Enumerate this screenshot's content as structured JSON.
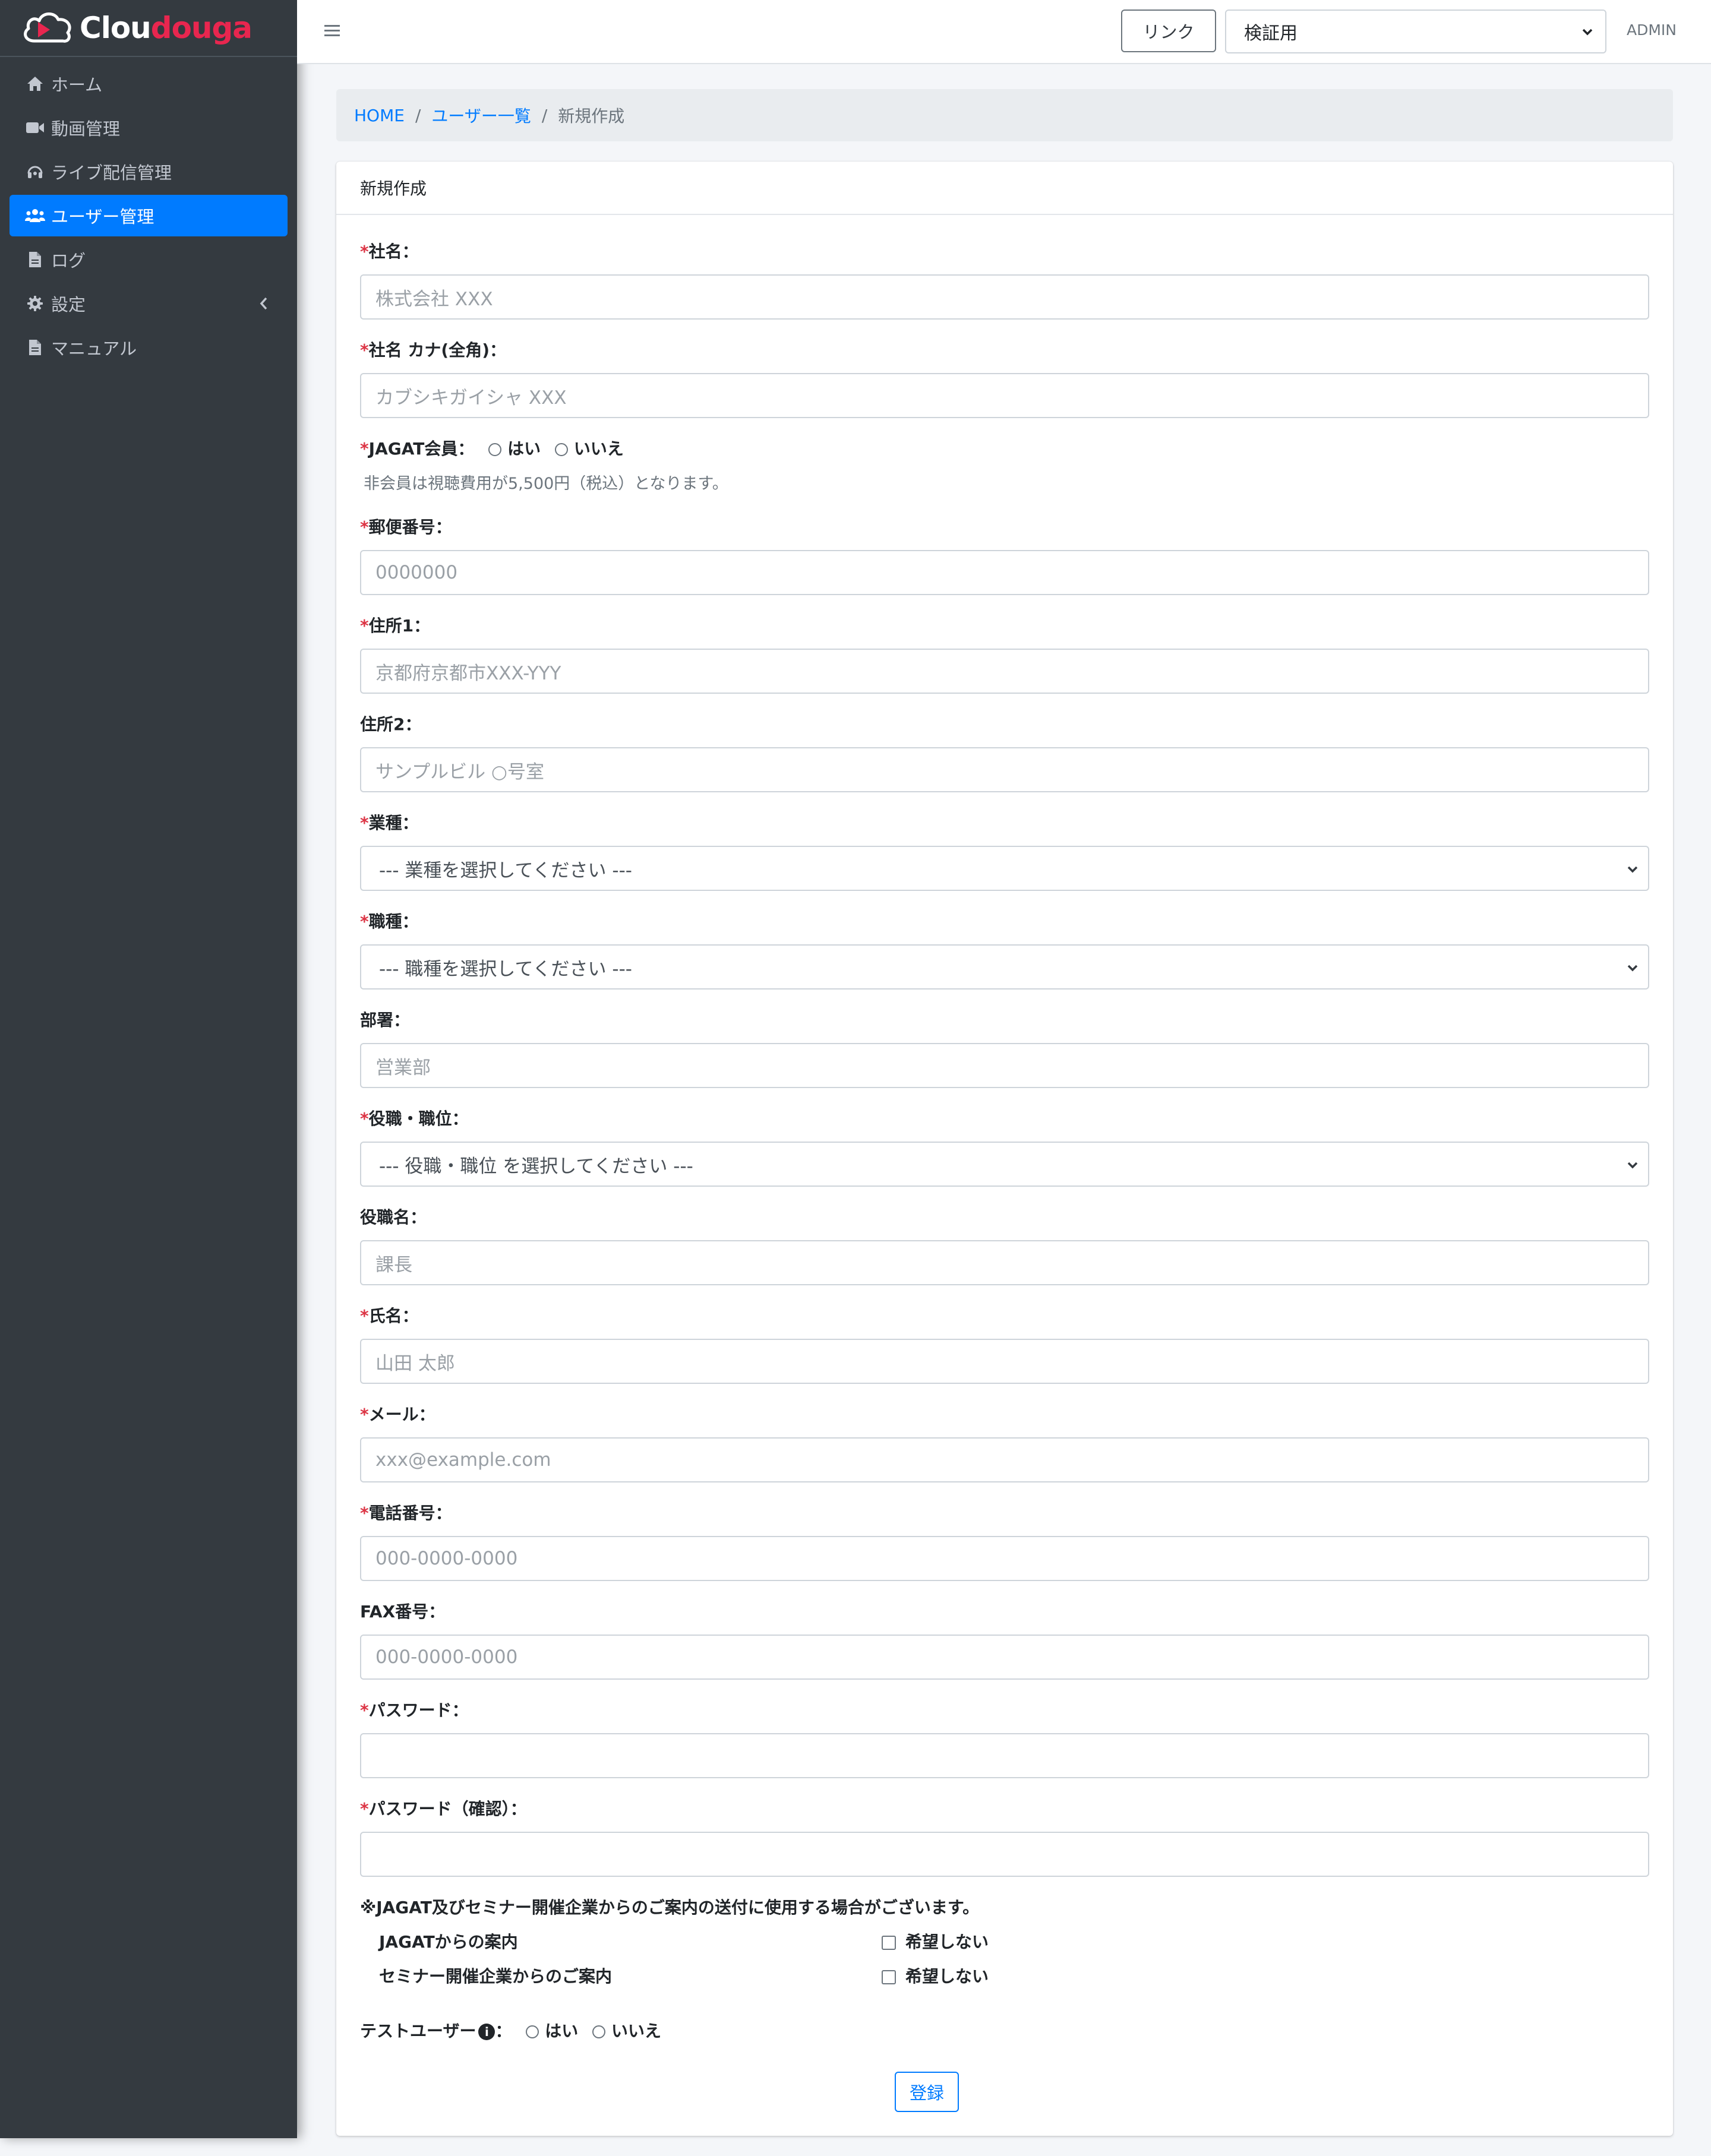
{
  "brand": {
    "part1": "Clou",
    "part2": "douga"
  },
  "colors": {
    "sidebar_bg": "#343a40",
    "accent": "#007bff",
    "brand_red": "#e8264f",
    "required": "#dc3545"
  },
  "sidebar": {
    "items": [
      {
        "label": "ホーム",
        "icon": "home-icon"
      },
      {
        "label": "動画管理",
        "icon": "video-camera-icon"
      },
      {
        "label": "ライブ配信管理",
        "icon": "headset-icon"
      },
      {
        "label": "ユーザー管理",
        "icon": "users-icon",
        "active": true
      },
      {
        "label": "ログ",
        "icon": "file-icon"
      },
      {
        "label": "設定",
        "icon": "gear-icon"
      },
      {
        "label": "マニュアル",
        "icon": "file-icon"
      }
    ]
  },
  "topbar": {
    "link_label": "リンク",
    "env_select_value": "検証用",
    "user_label": "ADMIN"
  },
  "breadcrumb": {
    "home": "HOME",
    "users": "ユーザー一覧",
    "current": "新規作成"
  },
  "card": {
    "title": "新規作成"
  },
  "form": {
    "required_mark": "*",
    "company_name": {
      "label": "社名：",
      "placeholder": "株式会社 XXX"
    },
    "company_kana": {
      "label": "社名 カナ(全角)：",
      "placeholder": "カブシキガイシャ XXX"
    },
    "jagat_member": {
      "label": "JAGAT会員：",
      "option_yes": "はい",
      "option_no": "いいえ",
      "help": "非会員は視聴費用が5,500円（税込）となります。"
    },
    "postal_code": {
      "label": "郵便番号：",
      "placeholder": "0000000"
    },
    "address1": {
      "label": "住所1：",
      "placeholder": "京都府京都市XXX-YYY"
    },
    "address2": {
      "label": "住所2：",
      "placeholder": "サンプルビル ○号室"
    },
    "industry": {
      "label": "業種：",
      "value": "--- 業種を選択してください ---"
    },
    "job_type": {
      "label": "職種：",
      "value": "--- 職種を選択してください ---"
    },
    "department": {
      "label": "部署：",
      "placeholder": "営業部"
    },
    "position": {
      "label": "役職・職位：",
      "value": "--- 役職・職位 を選択してください ---"
    },
    "position_name": {
      "label": "役職名：",
      "placeholder": "課長"
    },
    "full_name": {
      "label": "氏名：",
      "placeholder": "山田 太郎"
    },
    "email": {
      "label": "メール：",
      "placeholder": "xxx@example.com"
    },
    "phone": {
      "label": "電話番号：",
      "placeholder": "000-0000-0000"
    },
    "fax": {
      "label": "FAX番号：",
      "placeholder": "000-0000-0000"
    },
    "password": {
      "label": "パスワード："
    },
    "password_confirm": {
      "label": "パスワード（確認）："
    },
    "notice": "※JAGAT及びセミナー開催企業からのご案内の送付に使用する場合がございます。",
    "jagat_info": {
      "label": "JAGATからの案内",
      "checkbox": "希望しない"
    },
    "seminar_info": {
      "label": "セミナー開催企業からのご案内",
      "checkbox": "希望しない"
    },
    "test_user": {
      "label": "テストユーザー",
      "colon": "：",
      "info_glyph": "i",
      "option_yes": "はい",
      "option_no": "いいえ"
    },
    "submit_label": "登録"
  }
}
